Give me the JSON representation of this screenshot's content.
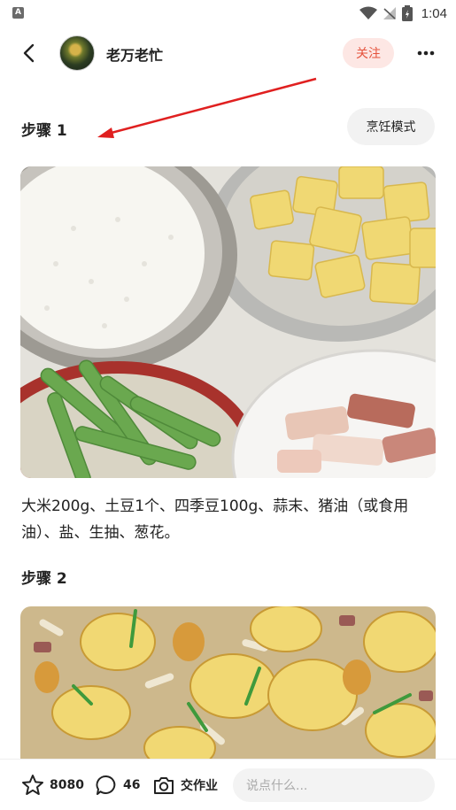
{
  "status_bar": {
    "app_badge": "A",
    "time": "1:04"
  },
  "header": {
    "author_name": "老万老忙",
    "follow_label": "关注"
  },
  "steps": [
    {
      "title": "步骤 1",
      "text": "大米200g、土豆1个、四季豆100g、蒜末、猪油（或食用油）、盐、生抽、葱花。"
    },
    {
      "title": "步骤 2"
    }
  ],
  "cook_mode_label": "烹饪模式",
  "bottom_bar": {
    "likes": "8080",
    "comments": "46",
    "homework_label": "交作业",
    "comment_placeholder": "说点什么..."
  },
  "colors": {
    "accent": "#e5533d",
    "follow_bg": "#fde7e4",
    "annotation_arrow": "#e02020"
  }
}
